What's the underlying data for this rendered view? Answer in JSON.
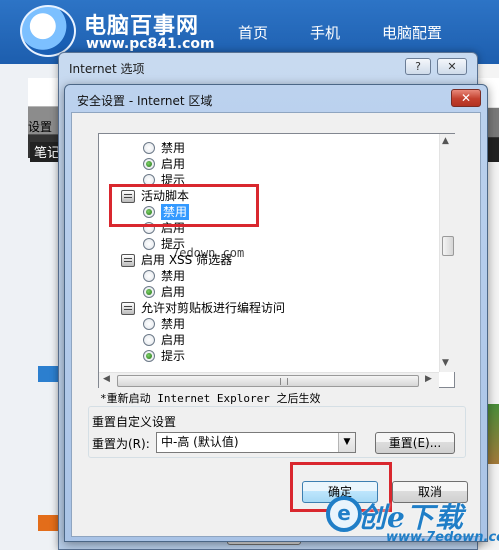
{
  "website": {
    "name": "电脑百事网",
    "url": "www.pc841.com",
    "nav": [
      "首页",
      "手机",
      "电脑配置"
    ],
    "thumb_tab": "笔记"
  },
  "outer_window": {
    "title": "Internet 选项",
    "help_glyph": "?",
    "close_glyph": "✕",
    "peek_ok_label": "确定"
  },
  "dialog": {
    "title": "安全设置 - Internet 区域",
    "close_glyph": "✕",
    "group_label": "设置",
    "settings": [
      {
        "type": "option",
        "label": "禁用",
        "checked": false
      },
      {
        "type": "option",
        "label": "启用",
        "checked": true
      },
      {
        "type": "option",
        "label": "提示",
        "checked": false
      },
      {
        "type": "category",
        "label": "活动脚本"
      },
      {
        "type": "option",
        "label": "禁用",
        "checked": true,
        "selected": true
      },
      {
        "type": "option",
        "label": "启用",
        "checked": false
      },
      {
        "type": "option",
        "label": "提示",
        "checked": false
      },
      {
        "type": "category",
        "label": "启用 XSS 筛选器"
      },
      {
        "type": "option",
        "label": "禁用",
        "checked": false
      },
      {
        "type": "option",
        "label": "启用",
        "checked": true
      },
      {
        "type": "category",
        "label": "允许对剪贴板进行编程访问"
      },
      {
        "type": "option",
        "label": "禁用",
        "checked": false
      },
      {
        "type": "option",
        "label": "启用",
        "checked": false
      },
      {
        "type": "option",
        "label": "提示",
        "checked": true
      }
    ],
    "restart_note": "*重新启动 Internet Explorer 之后生效",
    "reset_group_title": "重置自定义设置",
    "reset_to_label": "重置为(R):",
    "reset_level_value": "中-高 (默认值)",
    "reset_button": "重置(E)...",
    "ok_button": "确定",
    "cancel_button": "取消"
  },
  "watermark": {
    "center_text": "7edown.com",
    "logo_letter": "e",
    "logo_text": "创e下载",
    "logo_url": "www.7edown.com"
  },
  "colors": {
    "highlight": "#d9272e",
    "selection": "#3399ff",
    "site_blue": "#1d5eae",
    "dialog_close": "#c3402e"
  }
}
